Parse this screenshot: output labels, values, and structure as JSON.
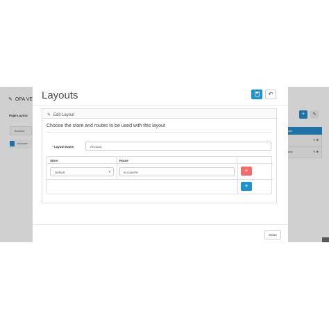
{
  "background": {
    "title": "OPA VE",
    "left_label": "Page Layout",
    "left_list_item": "Account",
    "left_row": "Account",
    "right_header": "Right",
    "right_rows": [
      "",
      "Home"
    ]
  },
  "modal": {
    "title": "Layouts",
    "save_icon": "save-icon",
    "reset_icon": "undo-icon",
    "panel_heading": "Edit Layout",
    "subtitle": "Choose the store and routes to be used with this layout",
    "layout_name_required_mark": "*",
    "layout_name_label": "Layout Name",
    "layout_name_value": "Account",
    "table": {
      "headers": [
        "Store",
        "Route"
      ],
      "rows": [
        {
          "store": "Default",
          "route": "account/%"
        }
      ]
    },
    "close_label": "Close"
  },
  "colors": {
    "primary": "#1e91cf",
    "danger": "#f56b6b",
    "overlay": "#d0d0d0"
  }
}
